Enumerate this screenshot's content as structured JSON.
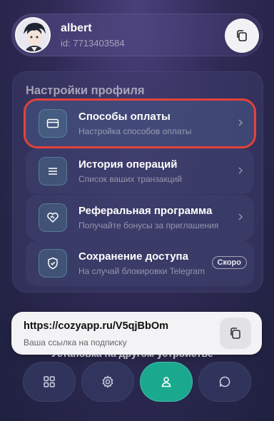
{
  "profile": {
    "username": "albert",
    "id_text": "id: 7713403584"
  },
  "settings": {
    "title": "Настройки профиля",
    "items": [
      {
        "label": "Способы оплаты",
        "sub": "Настройка способов оплаты",
        "icon": "credit-card-icon"
      },
      {
        "label": "История операций",
        "sub": "Список ваших транзакций",
        "icon": "list-icon"
      },
      {
        "label": "Реферальная программа",
        "sub": "Получайте бонусы за приглашения",
        "icon": "heart-handshake-icon"
      },
      {
        "label": "Сохранение доступа",
        "sub": "На случай блокировки Telegram",
        "icon": "shield-check-icon",
        "badge": "Скоро"
      }
    ],
    "partial_item_label": "Установка на другом устройстве"
  },
  "toast": {
    "link": "https://cozyapp.ru/V5qjBbOm",
    "sub": "Ваша ссылка на подписку"
  },
  "nav": [
    "grid-icon",
    "gear-icon",
    "user-icon",
    "chat-icon"
  ],
  "colors": {
    "highlight": "#e5423b",
    "nav_active": "#1aa98f"
  }
}
